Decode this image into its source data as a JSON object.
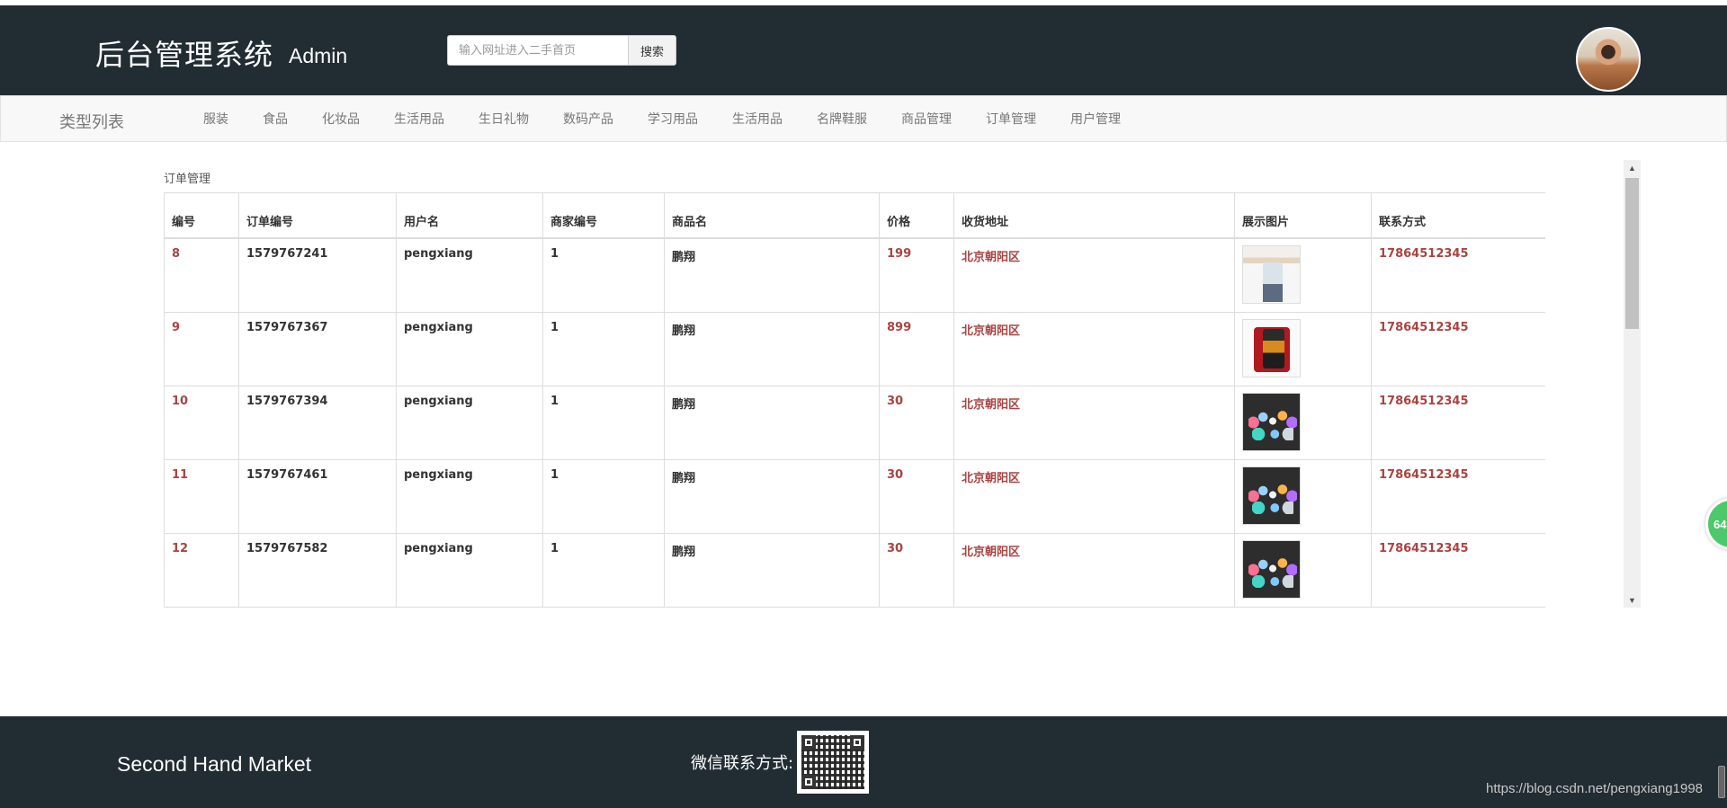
{
  "header": {
    "title": "后台管理系统",
    "subtitle": "Admin",
    "search": {
      "placeholder": "输入网址进入二手首页",
      "button_label": "搜索"
    }
  },
  "nav": {
    "title": "类型列表",
    "items": [
      {
        "label": "服装"
      },
      {
        "label": "食品"
      },
      {
        "label": "化妆品"
      },
      {
        "label": "生活用品"
      },
      {
        "label": "生日礼物"
      },
      {
        "label": "数码产品"
      },
      {
        "label": "学习用品"
      },
      {
        "label": "生活用品"
      },
      {
        "label": "名牌鞋服"
      },
      {
        "label": "商品管理"
      },
      {
        "label": "订单管理"
      },
      {
        "label": "用户管理"
      }
    ]
  },
  "section": {
    "title": "订单管理"
  },
  "orders": {
    "columns": [
      "编号",
      "订单编号",
      "用户名",
      "商家编号",
      "商品名",
      "价格",
      "收货地址",
      "展示图片",
      "联系方式"
    ],
    "rows": [
      {
        "id": "8",
        "order_no": "1579767241",
        "username": "pengxiang",
        "merchant_no": "1",
        "product": "鹏翔",
        "price": "199",
        "address": "北京朝阳区",
        "image": "shirt-photo",
        "contact": "17864512345"
      },
      {
        "id": "9",
        "order_no": "1579767367",
        "username": "pengxiang",
        "merchant_no": "1",
        "product": "鹏翔",
        "price": "899",
        "address": "北京朝阳区",
        "image": "phone-photo",
        "contact": "17864512345"
      },
      {
        "id": "10",
        "order_no": "1579767394",
        "username": "pengxiang",
        "merchant_no": "1",
        "product": "鹏翔",
        "price": "30",
        "address": "北京朝阳区",
        "image": "ipods-photo",
        "contact": "17864512345"
      },
      {
        "id": "11",
        "order_no": "1579767461",
        "username": "pengxiang",
        "merchant_no": "1",
        "product": "鹏翔",
        "price": "30",
        "address": "北京朝阳区",
        "image": "ipods-photo",
        "contact": "17864512345"
      },
      {
        "id": "12",
        "order_no": "1579767582",
        "username": "pengxiang",
        "merchant_no": "1",
        "product": "鹏翔",
        "price": "30",
        "address": "北京朝阳区",
        "image": "ipods-photo",
        "contact": "17864512345"
      }
    ]
  },
  "float_badge": {
    "text": "64"
  },
  "footer": {
    "brand": "Second Hand Market",
    "wechat_label": "微信联系方式:"
  },
  "watermark": "https://blog.csdn.net/pengxiang1998",
  "colors": {
    "dark_bar": "#222c33",
    "highlight_red": "#a94442",
    "badge_green": "#4cc96b"
  }
}
